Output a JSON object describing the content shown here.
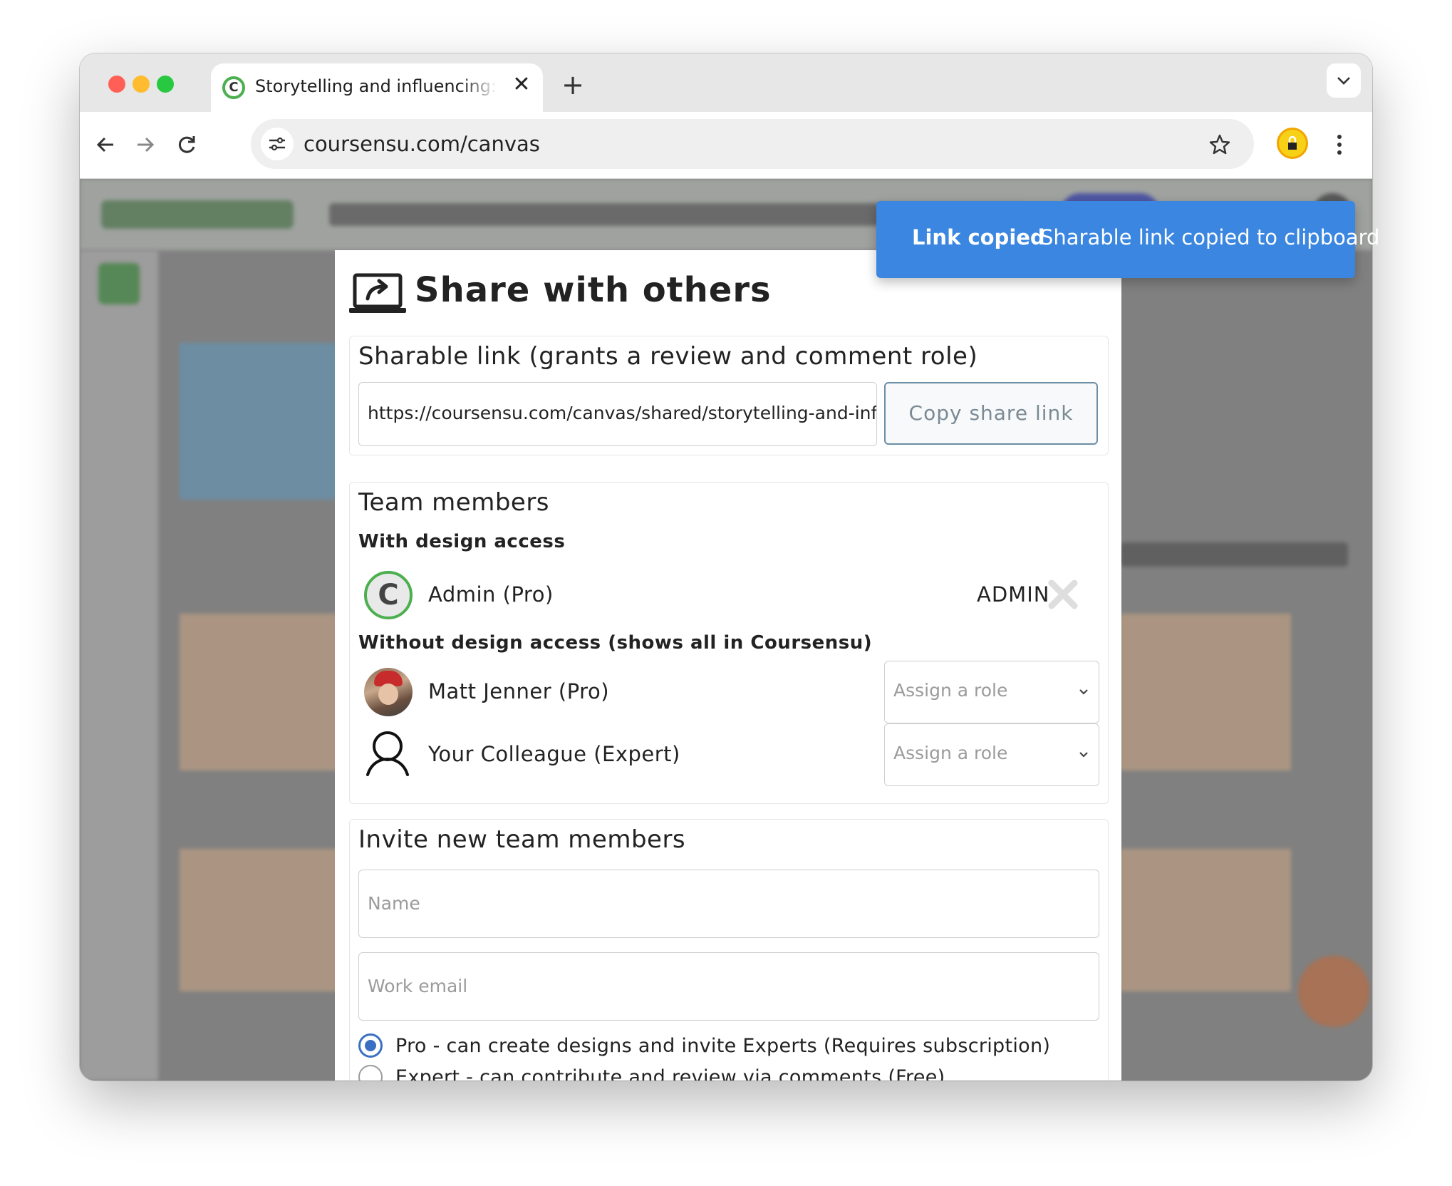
{
  "browser": {
    "tab_title": "Storytelling and influencing: Communicate with",
    "tab_close": "✕",
    "new_tab": "+",
    "dropdown": "⌄",
    "url": "coursensu.com/canvas",
    "favicon_letter": "C"
  },
  "modal": {
    "title": "Share with others",
    "sharable": {
      "heading": "Sharable link (grants a review and comment role)",
      "link_value": "https://coursensu.com/canvas/shared/storytelling-and-influencing",
      "copy_label": "Copy share link"
    },
    "team": {
      "heading": "Team members",
      "with_access_heading": "With design access",
      "admin_name": "Admin  (Pro)",
      "admin_role": "ADMIN",
      "without_access_heading": "Without design access (shows all in Coursensu)",
      "members": [
        {
          "name": "Matt Jenner (Pro)",
          "role_placeholder": "Assign a role"
        },
        {
          "name": "Your Colleague (Expert)",
          "role_placeholder": "Assign a role"
        }
      ]
    },
    "invite": {
      "heading": "Invite new team members",
      "name_placeholder": "Name",
      "email_placeholder": "Work email",
      "options": [
        {
          "label": "Pro - can create designs and invite Experts (Requires subscription)",
          "selected": true
        },
        {
          "label": "Expert - can contribute and review via comments (Free)",
          "selected": false
        }
      ]
    }
  },
  "toast": {
    "title": "Link copied",
    "message": "Sharable link copied to clipboard"
  },
  "colors": {
    "toast_bg": "#3a86e0",
    "radio_accent": "#3a6fc4",
    "brand_green": "#4caf50"
  }
}
